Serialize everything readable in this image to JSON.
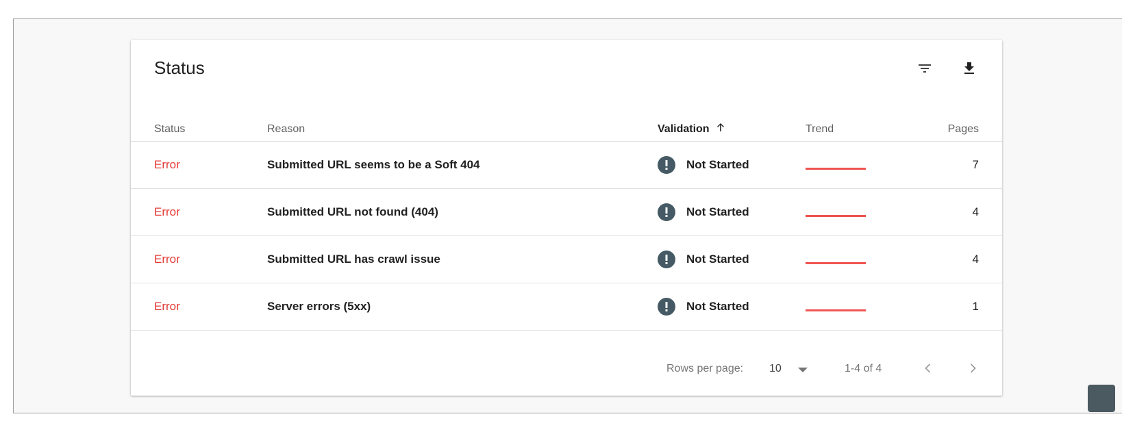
{
  "card": {
    "title": "Status",
    "filter_icon": "filter-icon",
    "download_icon": "download-icon"
  },
  "table": {
    "columns": {
      "status": "Status",
      "reason": "Reason",
      "validation": "Validation",
      "validation_sort_icon": "arrow-up-icon",
      "trend": "Trend",
      "pages": "Pages"
    },
    "rows": [
      {
        "status": "Error",
        "reason": "Submitted URL seems to be a Soft 404",
        "validation": "Not Started",
        "pages": "7"
      },
      {
        "status": "Error",
        "reason": "Submitted URL not found (404)",
        "validation": "Not Started",
        "pages": "4"
      },
      {
        "status": "Error",
        "reason": "Submitted URL has crawl issue",
        "validation": "Not Started",
        "pages": "4"
      },
      {
        "status": "Error",
        "reason": "Server errors (5xx)",
        "validation": "Not Started",
        "pages": "1"
      }
    ]
  },
  "pagination": {
    "rows_per_page_label": "Rows per page:",
    "rows_per_page_value": "10",
    "range": "1-4 of 4",
    "prev_icon": "chevron-left-icon",
    "next_icon": "chevron-right-icon"
  },
  "colors": {
    "error": "#e53935",
    "trend": "#ef5350",
    "alert_icon_bg": "#455a64"
  }
}
